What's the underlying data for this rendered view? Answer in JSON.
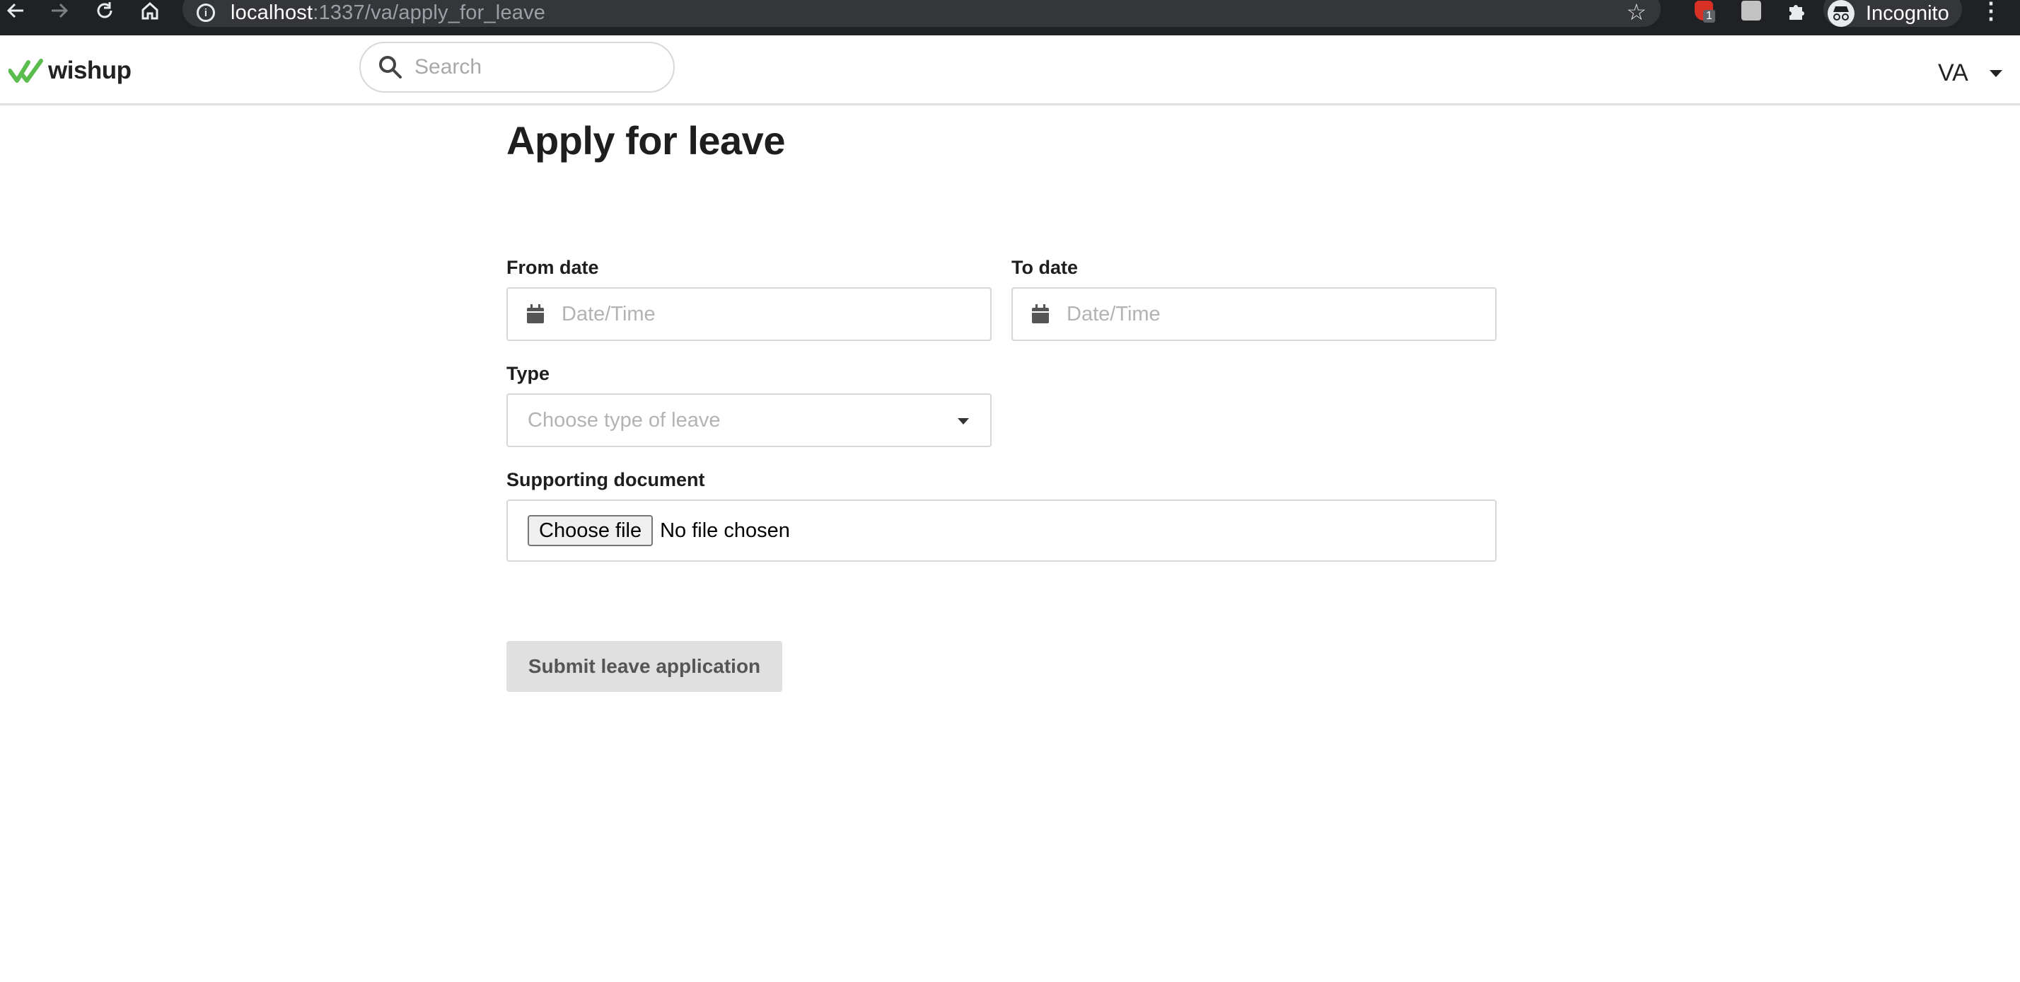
{
  "browser": {
    "url_host": "localhost",
    "url_path": ":1337/va/apply_for_leave",
    "extension_badge": "1",
    "profile_label": "Incognito"
  },
  "header": {
    "brand": "wishup",
    "search_placeholder": "Search",
    "user_initials": "VA"
  },
  "page": {
    "title": "Apply for leave"
  },
  "form": {
    "from_date": {
      "label": "From date",
      "placeholder": "Date/Time"
    },
    "to_date": {
      "label": "To date",
      "placeholder": "Date/Time"
    },
    "type": {
      "label": "Type",
      "placeholder": "Choose type of leave"
    },
    "supporting_document": {
      "label": "Supporting document",
      "button_label": "Choose file",
      "status": "No file chosen"
    },
    "submit_label": "Submit leave application"
  },
  "colors": {
    "brand_green": "#5bbd4e",
    "chrome_bg": "#202124",
    "submit_bg": "#e0e0e0"
  }
}
